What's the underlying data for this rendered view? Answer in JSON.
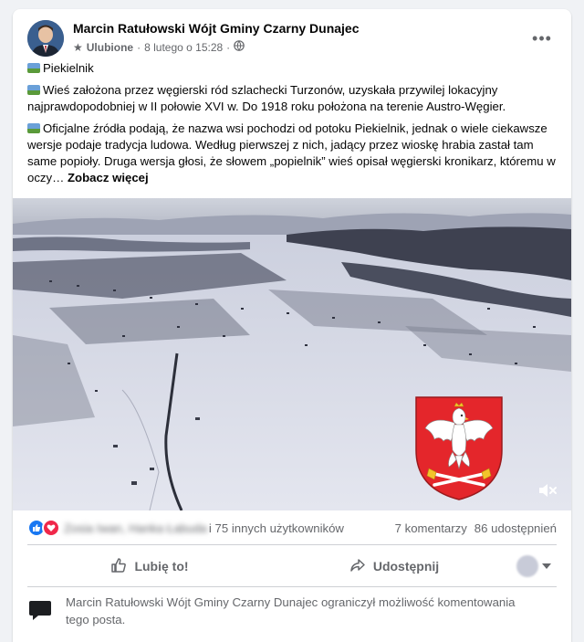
{
  "post": {
    "author": "Marcin Ratułowski Wójt Gminy Czarny Dunajec",
    "favorites_label": "Ulubione",
    "date": "8 lutego o 15:28",
    "privacy_icon": "globe-icon",
    "more_icon": "more-options-icon",
    "more_label": "•••",
    "title": "Piekielnik",
    "paragraph1": "Wieś założona przez węgierski ród szlachecki Turzonów, uzyskała przywilej lokacyjny najprawdopodobniej w II połowie XVI w. Do 1918 roku położona na terenie Austro-Węgier.",
    "paragraph2": "Oficjalne źródła podają, że nazwa wsi pochodzi od potoku Piekielnik, jednak o wiele ciekawsze wersje podaje tradycja ludowa. Według pierwszej z nich, jadący przez wioskę hrabia zastał tam same popioły. Druga wersja głosi, że słowem „popielnik” wieś opisał węgierski kronikarz, któremu w oczy…",
    "see_more": "Zobacz więcej"
  },
  "media": {
    "type": "video",
    "description_icon": "coat-of-arms-icon",
    "mute_icon": "muted-speaker-icon"
  },
  "reactions": {
    "names_blurred": "Zosia Iwan, Hanka Łabuda",
    "others": "i 75 innych użytkowników",
    "comments": "7 komentarzy",
    "shares": "86 udostępnień"
  },
  "actions": {
    "like": "Lubię to!",
    "share": "Udostępnij"
  },
  "notice": {
    "text": "Marcin Ratułowski Wójt Gminy Czarny Dunajec ograniczył możliwość komentowania tego posta."
  },
  "colors": {
    "like_blue": "#1877f2",
    "love_red": "#f0284a",
    "secondary_text": "#65676b",
    "coat_red": "#e4262b"
  }
}
